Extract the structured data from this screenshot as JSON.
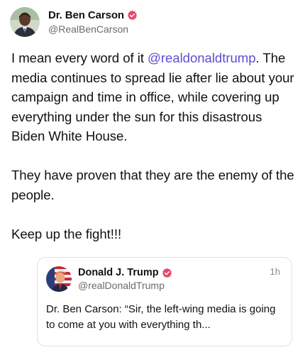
{
  "post": {
    "author": {
      "display_name": "Dr. Ben Carson",
      "handle": "@RealBenCarson",
      "verified": true,
      "avatar_icon": "person-avatar"
    },
    "text": {
      "p1_before": "I mean every word of it ",
      "p1_mention": "@realdonaldtrump",
      "p1_after": ". The media continues to spread lie after lie about your campaign and time in office, while covering up everything under the sun for this disastrous Biden White House.",
      "p2": "They have proven that they are the enemy of the people.",
      "p3": "Keep up the fight!!!"
    },
    "quoted": {
      "display_name": "Donald J. Trump",
      "handle": "@realDonaldTrump",
      "time": "1h",
      "verified": true,
      "avatar_icon": "person-avatar",
      "text": "Dr. Ben Carson: “Sir, the left-wing media is going to come at you with everything th..."
    }
  },
  "colors": {
    "mention": "#5b4fd1",
    "verified_badge": "#e8476b",
    "secondary_text": "#6b6b6b"
  }
}
